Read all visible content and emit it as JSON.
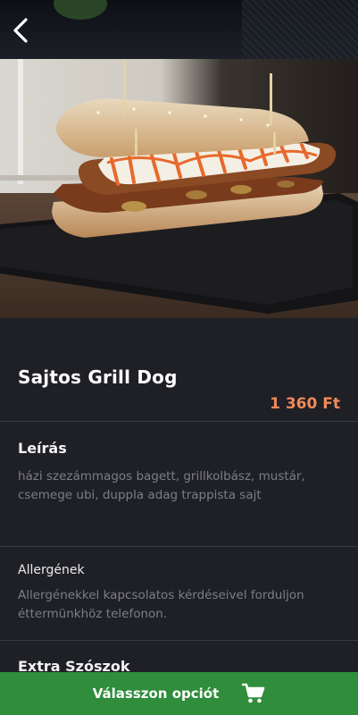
{
  "product": {
    "name": "Sajtos Grill Dog",
    "price": "1 360 Ft"
  },
  "description": {
    "title": "Leírás",
    "text": "házi szezámmagos bagett, grillkolbász, mustár, csemege ubi, duppla adag trappista sajt"
  },
  "allergens": {
    "title": "Allergének",
    "text": "Allergénekkel kapcsolatos kérdéseivel forduljon éttermünkhöz telefonon."
  },
  "extras": {
    "title": "Extra Szószok"
  },
  "cta": {
    "label": "Válasszon opciót"
  },
  "icons": {
    "back": "chevron-left-icon",
    "cart": "shopping-cart-icon"
  },
  "colors": {
    "price": "#f3895a",
    "cta_background": "#2f8d3c",
    "background": "#1f2025"
  }
}
